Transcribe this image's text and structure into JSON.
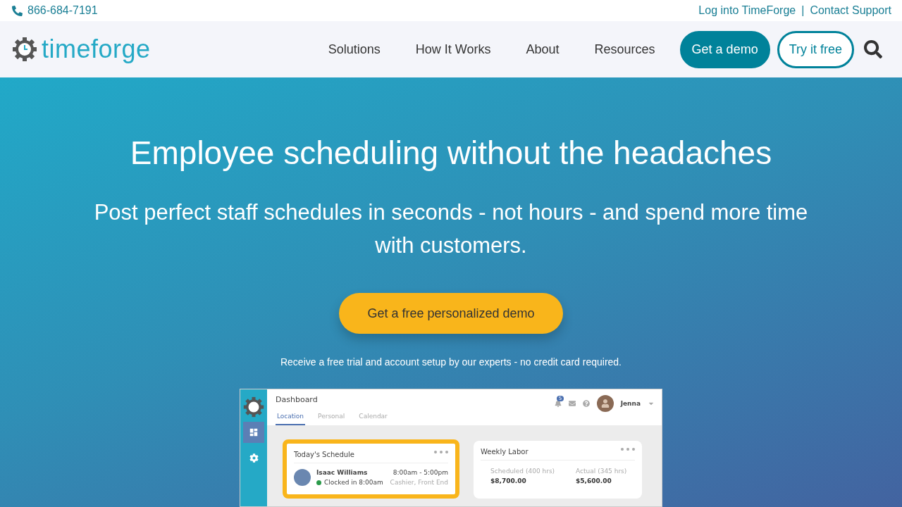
{
  "topbar": {
    "phone": "866-684-7191",
    "links": [
      {
        "label": "Log into TimeForge"
      },
      {
        "label": "Contact Support"
      }
    ],
    "separator": "|"
  },
  "nav": {
    "logo": "timeforge",
    "items": [
      {
        "label": "Solutions"
      },
      {
        "label": "How It Works"
      },
      {
        "label": "About"
      },
      {
        "label": "Resources"
      }
    ],
    "buttons": [
      {
        "label": "Get a demo",
        "kind": "filled"
      },
      {
        "label": "Try it free",
        "kind": "outline"
      }
    ]
  },
  "hero": {
    "title": "Employee scheduling without the headaches",
    "subtitle": "Post perfect staff schedules in seconds - not hours - and spend more time with customers.",
    "cta": "Get a free personalized demo",
    "note": "Receive a free trial and account setup by our experts - no credit card required."
  },
  "dashboard": {
    "title": "Dashboard",
    "tabs": [
      {
        "label": "Location",
        "selected": true
      },
      {
        "label": "Personal",
        "selected": false
      },
      {
        "label": "Calendar",
        "selected": false
      }
    ],
    "notifications": "5",
    "user": "Jenna",
    "sidebar": [
      {
        "kind": "grid",
        "selected": true
      },
      {
        "kind": "gear",
        "selected": false
      }
    ],
    "schedule": {
      "title": "Today's Schedule",
      "highlighted": true,
      "rows": [
        {
          "name": "Isaac Williams",
          "time": "8:00am - 5:00pm",
          "status": "Clocked in 8:00am",
          "role": "Cashier, Front End"
        }
      ]
    },
    "labor": {
      "title": "Weekly Labor",
      "highlighted": false,
      "stats": [
        {
          "label": "Scheduled (400 hrs)",
          "value": "$8,700.00"
        },
        {
          "label": "Actual (345 hrs)",
          "value": "$5,600.00"
        }
      ]
    }
  }
}
